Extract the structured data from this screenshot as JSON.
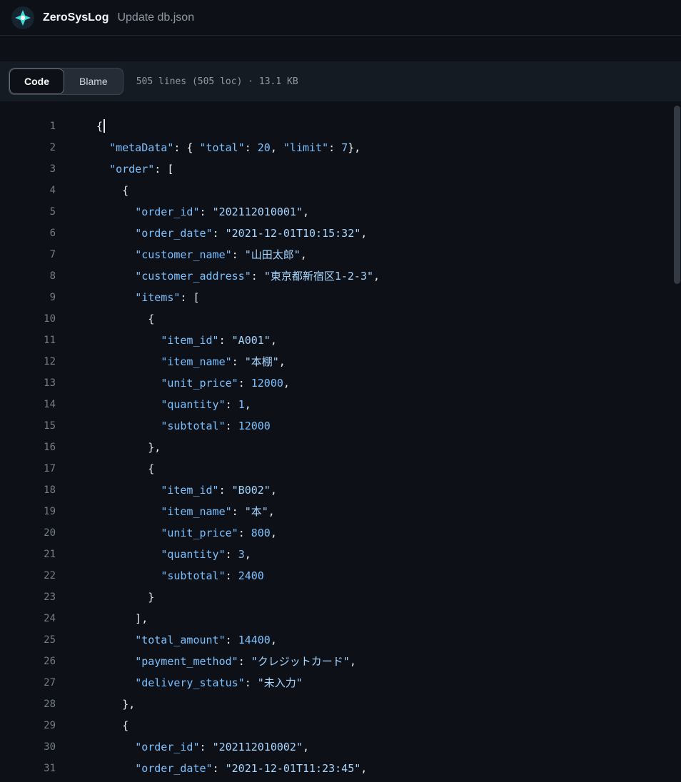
{
  "header": {
    "repo_name": "ZeroSysLog",
    "commit_message": "Update db.json"
  },
  "toolbar": {
    "tabs": [
      {
        "label": "Code",
        "active": true
      },
      {
        "label": "Blame",
        "active": false
      }
    ],
    "file_info": "505 lines (505 loc) · 13.1 KB"
  },
  "colors": {
    "bg": "#0d1117",
    "bg-toolbar": "#151b23",
    "bg-segment": "#262c36",
    "border": "#3d444d",
    "text-primary": "#f0f6fc",
    "text-muted": "#9198a1",
    "line-number": "#767d86",
    "syntax-plain": "#e6edf3",
    "syntax-key": "#79c0ff",
    "syntax-string": "#a5d6ff",
    "syntax-number": "#79c0ff",
    "avatar-teal": "#3ddbd9"
  },
  "code": {
    "lines": [
      {
        "num": 1,
        "caret": true,
        "tokens": [
          [
            "p",
            "{"
          ]
        ]
      },
      {
        "num": 2,
        "tokens": [
          [
            "p",
            "  "
          ],
          [
            "k",
            "\"metaData\""
          ],
          [
            "p",
            ": { "
          ],
          [
            "k",
            "\"total\""
          ],
          [
            "p",
            ": "
          ],
          [
            "n",
            "20"
          ],
          [
            "p",
            ", "
          ],
          [
            "k",
            "\"limit\""
          ],
          [
            "p",
            ": "
          ],
          [
            "n",
            "7"
          ],
          [
            "p",
            "},"
          ]
        ]
      },
      {
        "num": 3,
        "tokens": [
          [
            "p",
            "  "
          ],
          [
            "k",
            "\"order\""
          ],
          [
            "p",
            ": ["
          ]
        ]
      },
      {
        "num": 4,
        "tokens": [
          [
            "p",
            "    {"
          ]
        ]
      },
      {
        "num": 5,
        "tokens": [
          [
            "p",
            "      "
          ],
          [
            "k",
            "\"order_id\""
          ],
          [
            "p",
            ": "
          ],
          [
            "s",
            "\"202112010001\""
          ],
          [
            "p",
            ","
          ]
        ]
      },
      {
        "num": 6,
        "tokens": [
          [
            "p",
            "      "
          ],
          [
            "k",
            "\"order_date\""
          ],
          [
            "p",
            ": "
          ],
          [
            "s",
            "\"2021-12-01T10:15:32\""
          ],
          [
            "p",
            ","
          ]
        ]
      },
      {
        "num": 7,
        "tokens": [
          [
            "p",
            "      "
          ],
          [
            "k",
            "\"customer_name\""
          ],
          [
            "p",
            ": "
          ],
          [
            "s",
            "\"山田太郎\""
          ],
          [
            "p",
            ","
          ]
        ]
      },
      {
        "num": 8,
        "tokens": [
          [
            "p",
            "      "
          ],
          [
            "k",
            "\"customer_address\""
          ],
          [
            "p",
            ": "
          ],
          [
            "s",
            "\"東京都新宿区1-2-3\""
          ],
          [
            "p",
            ","
          ]
        ]
      },
      {
        "num": 9,
        "tokens": [
          [
            "p",
            "      "
          ],
          [
            "k",
            "\"items\""
          ],
          [
            "p",
            ": ["
          ]
        ]
      },
      {
        "num": 10,
        "tokens": [
          [
            "p",
            "        {"
          ]
        ]
      },
      {
        "num": 11,
        "tokens": [
          [
            "p",
            "          "
          ],
          [
            "k",
            "\"item_id\""
          ],
          [
            "p",
            ": "
          ],
          [
            "s",
            "\"A001\""
          ],
          [
            "p",
            ","
          ]
        ]
      },
      {
        "num": 12,
        "tokens": [
          [
            "p",
            "          "
          ],
          [
            "k",
            "\"item_name\""
          ],
          [
            "p",
            ": "
          ],
          [
            "s",
            "\"本棚\""
          ],
          [
            "p",
            ","
          ]
        ]
      },
      {
        "num": 13,
        "tokens": [
          [
            "p",
            "          "
          ],
          [
            "k",
            "\"unit_price\""
          ],
          [
            "p",
            ": "
          ],
          [
            "n",
            "12000"
          ],
          [
            "p",
            ","
          ]
        ]
      },
      {
        "num": 14,
        "tokens": [
          [
            "p",
            "          "
          ],
          [
            "k",
            "\"quantity\""
          ],
          [
            "p",
            ": "
          ],
          [
            "n",
            "1"
          ],
          [
            "p",
            ","
          ]
        ]
      },
      {
        "num": 15,
        "tokens": [
          [
            "p",
            "          "
          ],
          [
            "k",
            "\"subtotal\""
          ],
          [
            "p",
            ": "
          ],
          [
            "n",
            "12000"
          ]
        ]
      },
      {
        "num": 16,
        "tokens": [
          [
            "p",
            "        },"
          ]
        ]
      },
      {
        "num": 17,
        "tokens": [
          [
            "p",
            "        {"
          ]
        ]
      },
      {
        "num": 18,
        "tokens": [
          [
            "p",
            "          "
          ],
          [
            "k",
            "\"item_id\""
          ],
          [
            "p",
            ": "
          ],
          [
            "s",
            "\"B002\""
          ],
          [
            "p",
            ","
          ]
        ]
      },
      {
        "num": 19,
        "tokens": [
          [
            "p",
            "          "
          ],
          [
            "k",
            "\"item_name\""
          ],
          [
            "p",
            ": "
          ],
          [
            "s",
            "\"本\""
          ],
          [
            "p",
            ","
          ]
        ]
      },
      {
        "num": 20,
        "tokens": [
          [
            "p",
            "          "
          ],
          [
            "k",
            "\"unit_price\""
          ],
          [
            "p",
            ": "
          ],
          [
            "n",
            "800"
          ],
          [
            "p",
            ","
          ]
        ]
      },
      {
        "num": 21,
        "tokens": [
          [
            "p",
            "          "
          ],
          [
            "k",
            "\"quantity\""
          ],
          [
            "p",
            ": "
          ],
          [
            "n",
            "3"
          ],
          [
            "p",
            ","
          ]
        ]
      },
      {
        "num": 22,
        "tokens": [
          [
            "p",
            "          "
          ],
          [
            "k",
            "\"subtotal\""
          ],
          [
            "p",
            ": "
          ],
          [
            "n",
            "2400"
          ]
        ]
      },
      {
        "num": 23,
        "tokens": [
          [
            "p",
            "        }"
          ]
        ]
      },
      {
        "num": 24,
        "tokens": [
          [
            "p",
            "      ],"
          ]
        ]
      },
      {
        "num": 25,
        "tokens": [
          [
            "p",
            "      "
          ],
          [
            "k",
            "\"total_amount\""
          ],
          [
            "p",
            ": "
          ],
          [
            "n",
            "14400"
          ],
          [
            "p",
            ","
          ]
        ]
      },
      {
        "num": 26,
        "tokens": [
          [
            "p",
            "      "
          ],
          [
            "k",
            "\"payment_method\""
          ],
          [
            "p",
            ": "
          ],
          [
            "s",
            "\"クレジットカード\""
          ],
          [
            "p",
            ","
          ]
        ]
      },
      {
        "num": 27,
        "tokens": [
          [
            "p",
            "      "
          ],
          [
            "k",
            "\"delivery_status\""
          ],
          [
            "p",
            ": "
          ],
          [
            "s",
            "\"未入力\""
          ]
        ]
      },
      {
        "num": 28,
        "tokens": [
          [
            "p",
            "    },"
          ]
        ]
      },
      {
        "num": 29,
        "tokens": [
          [
            "p",
            "    {"
          ]
        ]
      },
      {
        "num": 30,
        "tokens": [
          [
            "p",
            "      "
          ],
          [
            "k",
            "\"order_id\""
          ],
          [
            "p",
            ": "
          ],
          [
            "s",
            "\"202112010002\""
          ],
          [
            "p",
            ","
          ]
        ]
      },
      {
        "num": 31,
        "tokens": [
          [
            "p",
            "      "
          ],
          [
            "k",
            "\"order_date\""
          ],
          [
            "p",
            ": "
          ],
          [
            "s",
            "\"2021-12-01T11:23:45\""
          ],
          [
            "p",
            ","
          ]
        ]
      }
    ]
  }
}
